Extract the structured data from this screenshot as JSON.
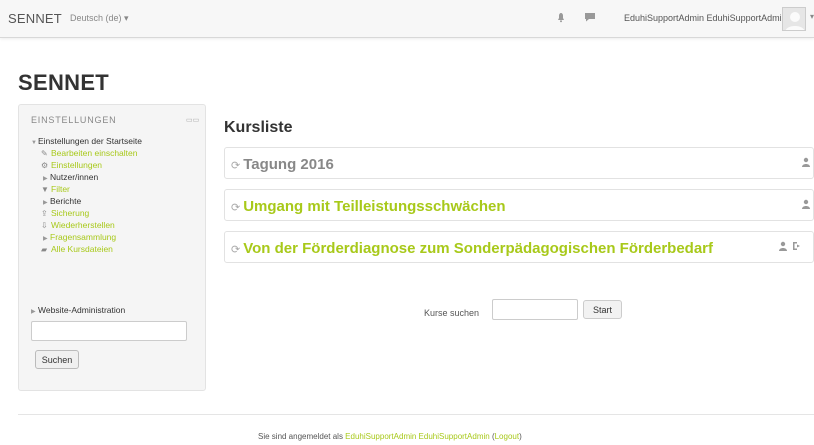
{
  "navbar": {
    "brand": "SENNET",
    "language": "Deutsch (de) ▾",
    "user_name": "EduhiSupportAdmin EduhiSupportAdmin",
    "caret": "▾",
    "icons": [
      "notification-icon",
      "message-icon"
    ]
  },
  "page": {
    "heading": "SENNET"
  },
  "settings_block": {
    "title": "EINSTELLUNGEN",
    "control_icons": [
      "dock-icon",
      "collapse-icon"
    ],
    "items": [
      {
        "label": "Einstellungen der Startseite",
        "type": "branch-open",
        "link": false
      },
      {
        "label": "Bearbeiten einschalten",
        "icon": "pencil-icon",
        "link": true
      },
      {
        "label": "Einstellungen",
        "icon": "gear-icon",
        "link": true
      },
      {
        "label": "Nutzer/innen",
        "type": "branch",
        "link": false
      },
      {
        "label": "Filter",
        "icon": "filter-icon",
        "link": true
      },
      {
        "label": "Berichte",
        "type": "branch",
        "link": false
      },
      {
        "label": "Sicherung",
        "icon": "backup-icon",
        "link": true
      },
      {
        "label": "Wiederherstellen",
        "icon": "restore-icon",
        "link": true
      },
      {
        "label": "Fragensammlung",
        "type": "branch",
        "link": true
      },
      {
        "label": "Alle Kursdateien",
        "icon": "folder-icon",
        "link": true
      },
      {
        "label": "Website-Administration",
        "type": "branch",
        "link": false
      }
    ],
    "search_button": "Suchen"
  },
  "course_list": {
    "title": "Kursliste",
    "courses": [
      {
        "name": "Tagung 2016",
        "color": "#888888"
      },
      {
        "name": "Umgang mit Teilleistungsschwächen",
        "color": "#a8c91a"
      },
      {
        "name": "Von der Förderdiagnose zum Sonderpädagogischen Förderbedarf",
        "color": "#a8c91a"
      }
    ]
  },
  "course_search": {
    "label": "Kurse suchen",
    "button": "Start"
  },
  "footer": {
    "prefix": "Sie sind angemeldet als ",
    "user": "EduhiSupportAdmin EduhiSupportAdmin",
    "open": " (",
    "logout": "Logout",
    "close": ")"
  },
  "colors": {
    "accent": "#a8c91a",
    "muted": "#888888"
  }
}
